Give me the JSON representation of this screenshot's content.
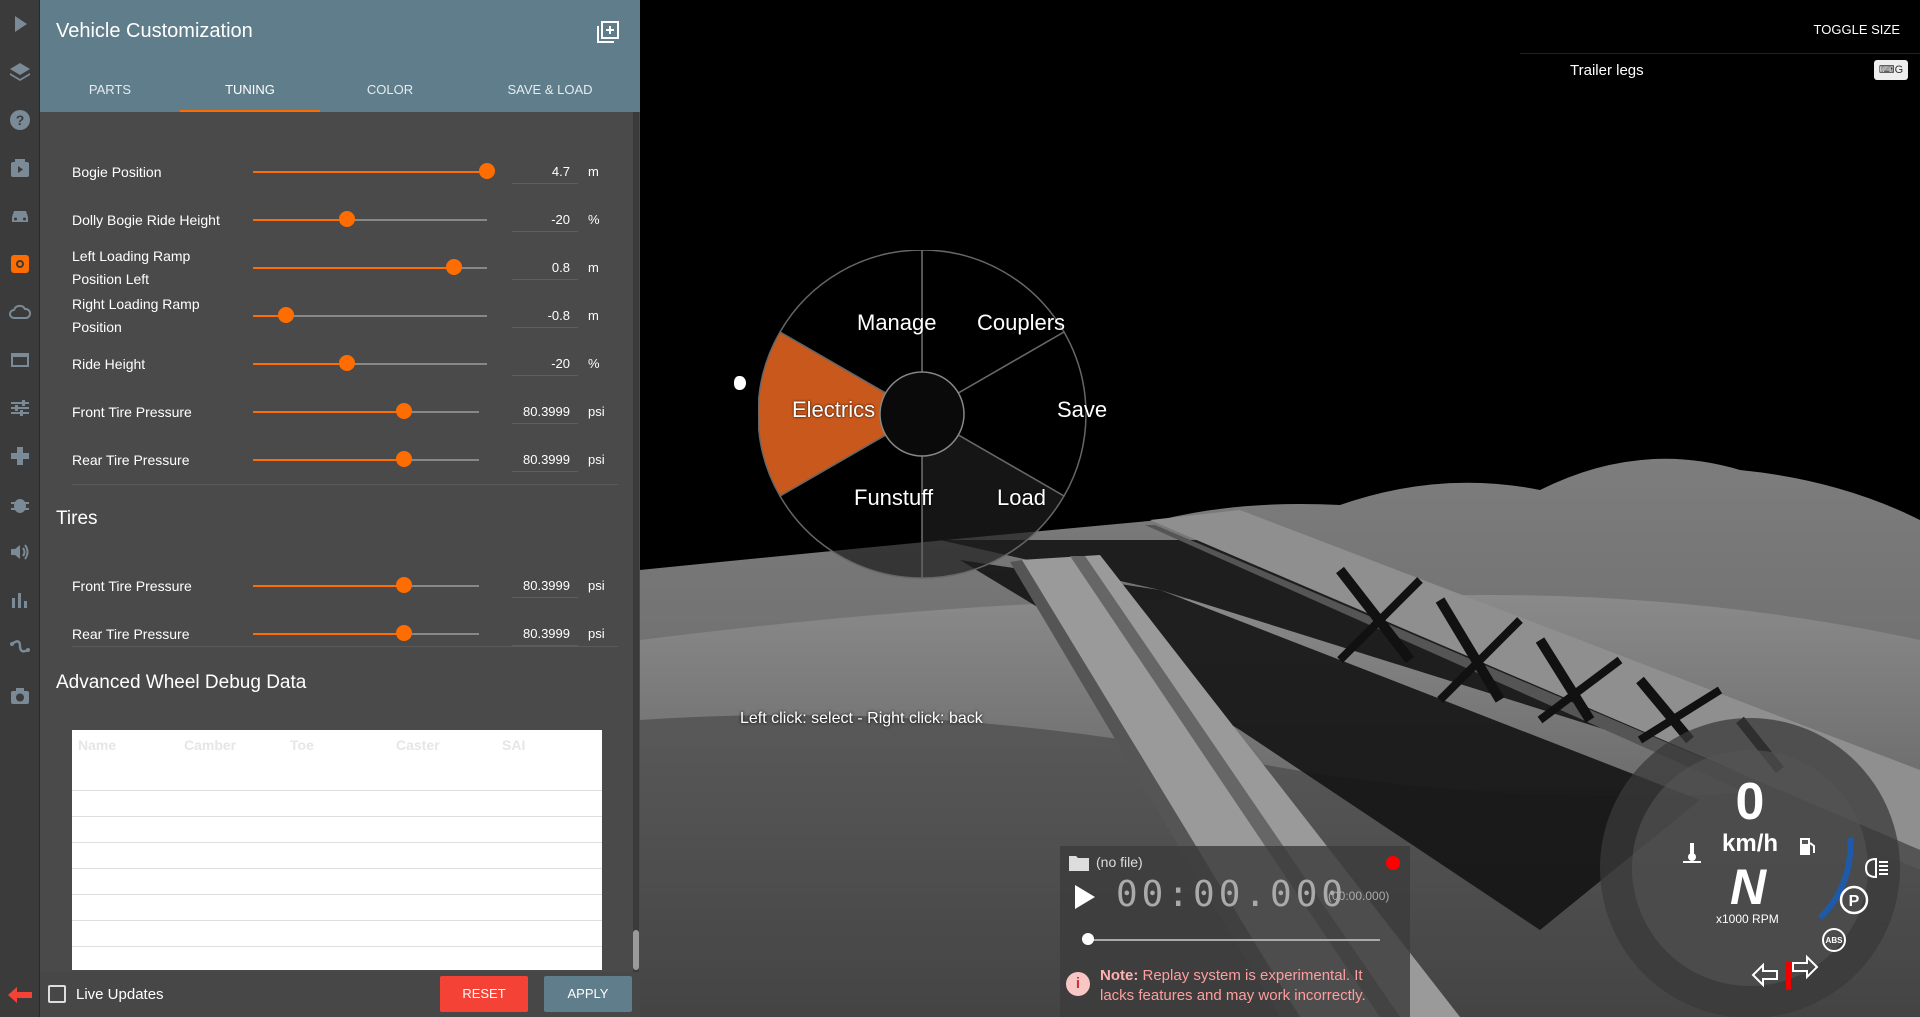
{
  "panel": {
    "title": "Vehicle Customization",
    "tabs": [
      {
        "label": "PARTS"
      },
      {
        "label": "TUNING"
      },
      {
        "label": "COLOR"
      },
      {
        "label": "SAVE & LOAD"
      }
    ],
    "active_tab": "TUNING",
    "tuning_rows": [
      {
        "label": "Bogie Position",
        "value": "4.7",
        "unit": "m",
        "fraction": 1.0
      },
      {
        "label": "Dolly Bogie Ride Height",
        "value": "-20",
        "unit": "%",
        "fraction": 0.4
      },
      {
        "label": "Left Loading Ramp Position Left",
        "value": "0.8",
        "unit": "m",
        "fraction": 0.857
      },
      {
        "label": "Right Loading Ramp Position",
        "value": "-0.8",
        "unit": "m",
        "fraction": 0.143
      },
      {
        "label": "Ride Height",
        "value": "-20",
        "unit": "%",
        "fraction": 0.4
      },
      {
        "label": "Front Tire Pressure",
        "value": "80.3999",
        "unit": "psi",
        "fraction": 0.67
      },
      {
        "label": "Rear Tire Pressure",
        "value": "80.3999",
        "unit": "psi",
        "fraction": 0.67
      }
    ],
    "tires_title": "Tires",
    "tires_rows": [
      {
        "label": "Front Tire Pressure",
        "value": "80.3999",
        "unit": "psi",
        "fraction": 0.67
      },
      {
        "label": "Rear Tire Pressure",
        "value": "80.3999",
        "unit": "psi",
        "fraction": 0.67
      }
    ],
    "debug_title": "Advanced Wheel Debug Data",
    "debug_columns": [
      "Name",
      "Camber",
      "Toe",
      "Caster",
      "SAI"
    ],
    "live_updates_label": "Live Updates",
    "live_updates_checked": false,
    "reset_label": "RESET",
    "apply_label": "APPLY"
  },
  "rail_icons": [
    "play-icon",
    "layers-icon",
    "help-icon",
    "video-icon",
    "car-icon",
    "gear-icon",
    "cloud-icon",
    "window-icon",
    "sliders-icon",
    "gamepad-icon",
    "bug-icon",
    "volume-icon",
    "bar-chart-icon",
    "route-icon",
    "camera-icon"
  ],
  "active_rail_icon": "gear-icon",
  "viewport": {
    "toggle_size": "TOGGLE SIZE",
    "trailer_legs": "Trailer legs",
    "keybind_hint": "⌨G"
  },
  "radial_menu": {
    "items": [
      "Manage",
      "Couplers",
      "Save",
      "Load",
      "Funstuff",
      "Electrics"
    ],
    "selected": "Electrics",
    "hint": "Left click: select - Right click: back"
  },
  "replay": {
    "file": "(no file)",
    "time": "00:00.000",
    "time_sub": "(00:00.000)",
    "progress": 0,
    "note_bold": "Note:",
    "note_text": " Replay system is experimental. It lacks features and may work incorrectly."
  },
  "dashboard": {
    "speed": "0",
    "speed_unit": "km/h",
    "gear": "N",
    "rpm_label": "x1000 RPM"
  },
  "colors": {
    "accent": "#ff6d00",
    "header": "#607d8b",
    "panel": "#4a4a4a",
    "reset": "#f44336",
    "selected_slice": "#c8581c"
  }
}
